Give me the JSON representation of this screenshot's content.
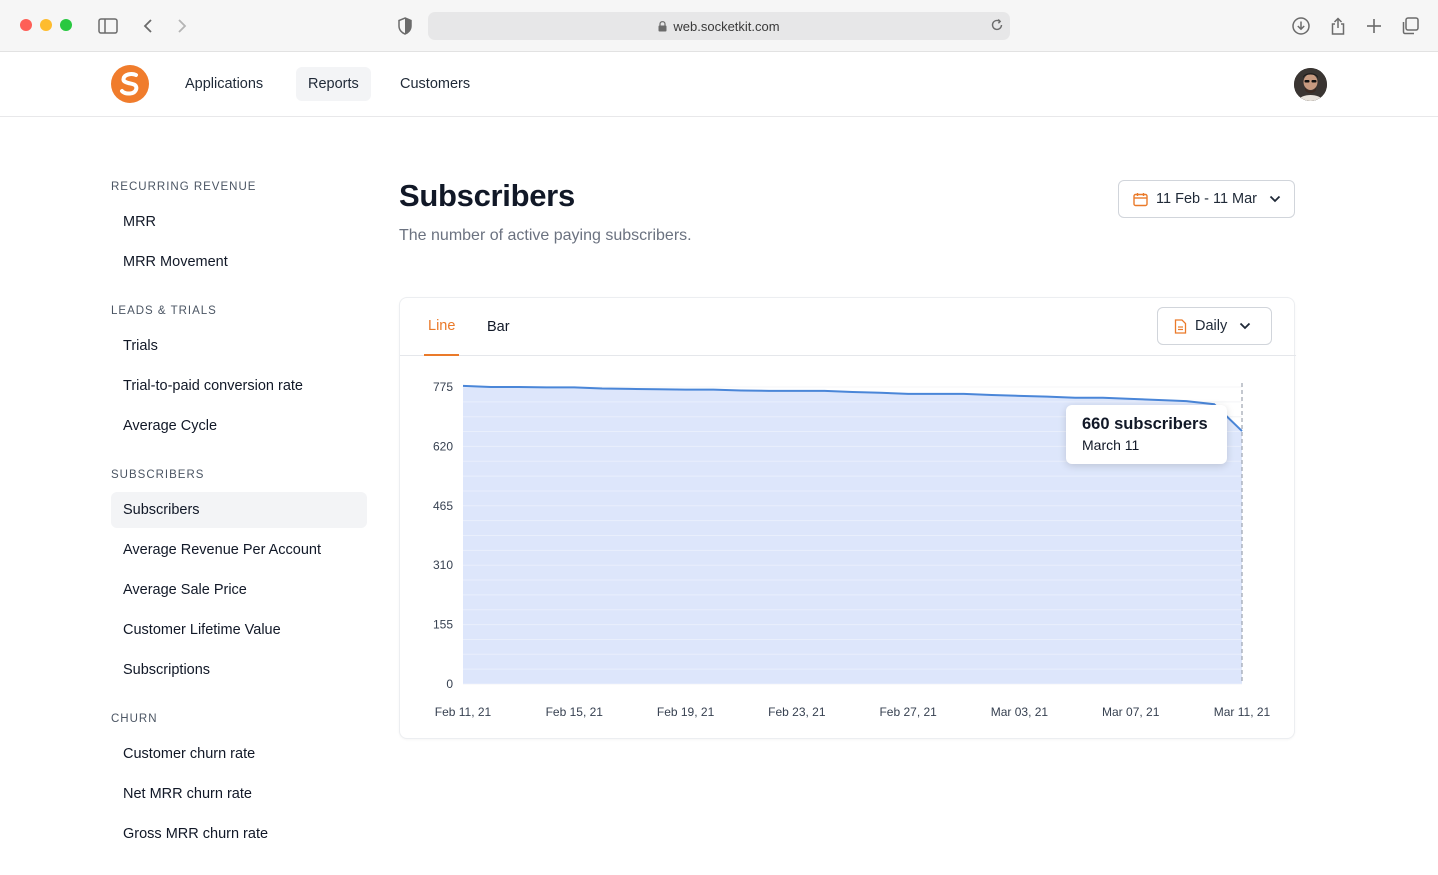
{
  "browser": {
    "url": "web.socketkit.com"
  },
  "nav": {
    "items": [
      {
        "label": "Applications",
        "active": false
      },
      {
        "label": "Reports",
        "active": true
      },
      {
        "label": "Customers",
        "active": false
      }
    ]
  },
  "sidebar": {
    "sections": [
      {
        "title": "RECURRING REVENUE",
        "items": [
          {
            "label": "MRR"
          },
          {
            "label": "MRR Movement"
          }
        ]
      },
      {
        "title": "LEADS & TRIALS",
        "items": [
          {
            "label": "Trials"
          },
          {
            "label": "Trial-to-paid conversion rate"
          },
          {
            "label": "Average Cycle"
          }
        ]
      },
      {
        "title": "SUBSCRIBERS",
        "items": [
          {
            "label": "Subscribers",
            "active": true
          },
          {
            "label": "Average Revenue Per Account"
          },
          {
            "label": "Average Sale Price"
          },
          {
            "label": "Customer Lifetime Value"
          },
          {
            "label": "Subscriptions"
          }
        ]
      },
      {
        "title": "CHURN",
        "items": [
          {
            "label": "Customer churn rate"
          },
          {
            "label": "Net MRR churn rate"
          },
          {
            "label": "Gross MRR churn rate"
          }
        ]
      }
    ]
  },
  "page": {
    "title": "Subscribers",
    "subtitle": "The number of active paying subscribers.",
    "date_range": "11 Feb - 11 Mar"
  },
  "chart_card": {
    "tabs": [
      {
        "label": "Line",
        "active": true
      },
      {
        "label": "Bar",
        "active": false
      }
    ],
    "interval": "Daily"
  },
  "tooltip": {
    "value": "660 subscribers",
    "date": "March 11"
  },
  "colors": {
    "accent": "#ea7a2a",
    "line": "#4a86d8",
    "area": "#dbe5fb"
  },
  "chart_data": {
    "type": "area",
    "x": [
      "Feb 11, 21",
      "Feb 12, 21",
      "Feb 13, 21",
      "Feb 14, 21",
      "Feb 15, 21",
      "Feb 16, 21",
      "Feb 17, 21",
      "Feb 18, 21",
      "Feb 19, 21",
      "Feb 20, 21",
      "Feb 21, 21",
      "Feb 22, 21",
      "Feb 23, 21",
      "Feb 24, 21",
      "Feb 25, 21",
      "Feb 26, 21",
      "Feb 27, 21",
      "Feb 28, 21",
      "Mar 01, 21",
      "Mar 02, 21",
      "Mar 03, 21",
      "Mar 04, 21",
      "Mar 05, 21",
      "Mar 06, 21",
      "Mar 07, 21",
      "Mar 08, 21",
      "Mar 09, 21",
      "Mar 10, 21",
      "Mar 11, 21"
    ],
    "x_tick_labels": [
      "Feb 11, 21",
      "Feb 15, 21",
      "Feb 19, 21",
      "Feb 23, 21",
      "Feb 27, 21",
      "Mar 03, 21",
      "Mar 07, 21",
      "Mar 11, 21"
    ],
    "y_ticks": [
      "0",
      "155",
      "310",
      "465",
      "620",
      "775"
    ],
    "series": [
      {
        "values": [
          778,
          775,
          775,
          774,
          774,
          771,
          770,
          769,
          768,
          768,
          766,
          765,
          765,
          765,
          762,
          760,
          757,
          757,
          757,
          754,
          752,
          750,
          747,
          747,
          744,
          741,
          738,
          730,
          660
        ]
      }
    ],
    "ylim": [
      0,
      775
    ],
    "grid": true,
    "highlight": {
      "x": "Mar 11, 21",
      "value": 660
    }
  }
}
